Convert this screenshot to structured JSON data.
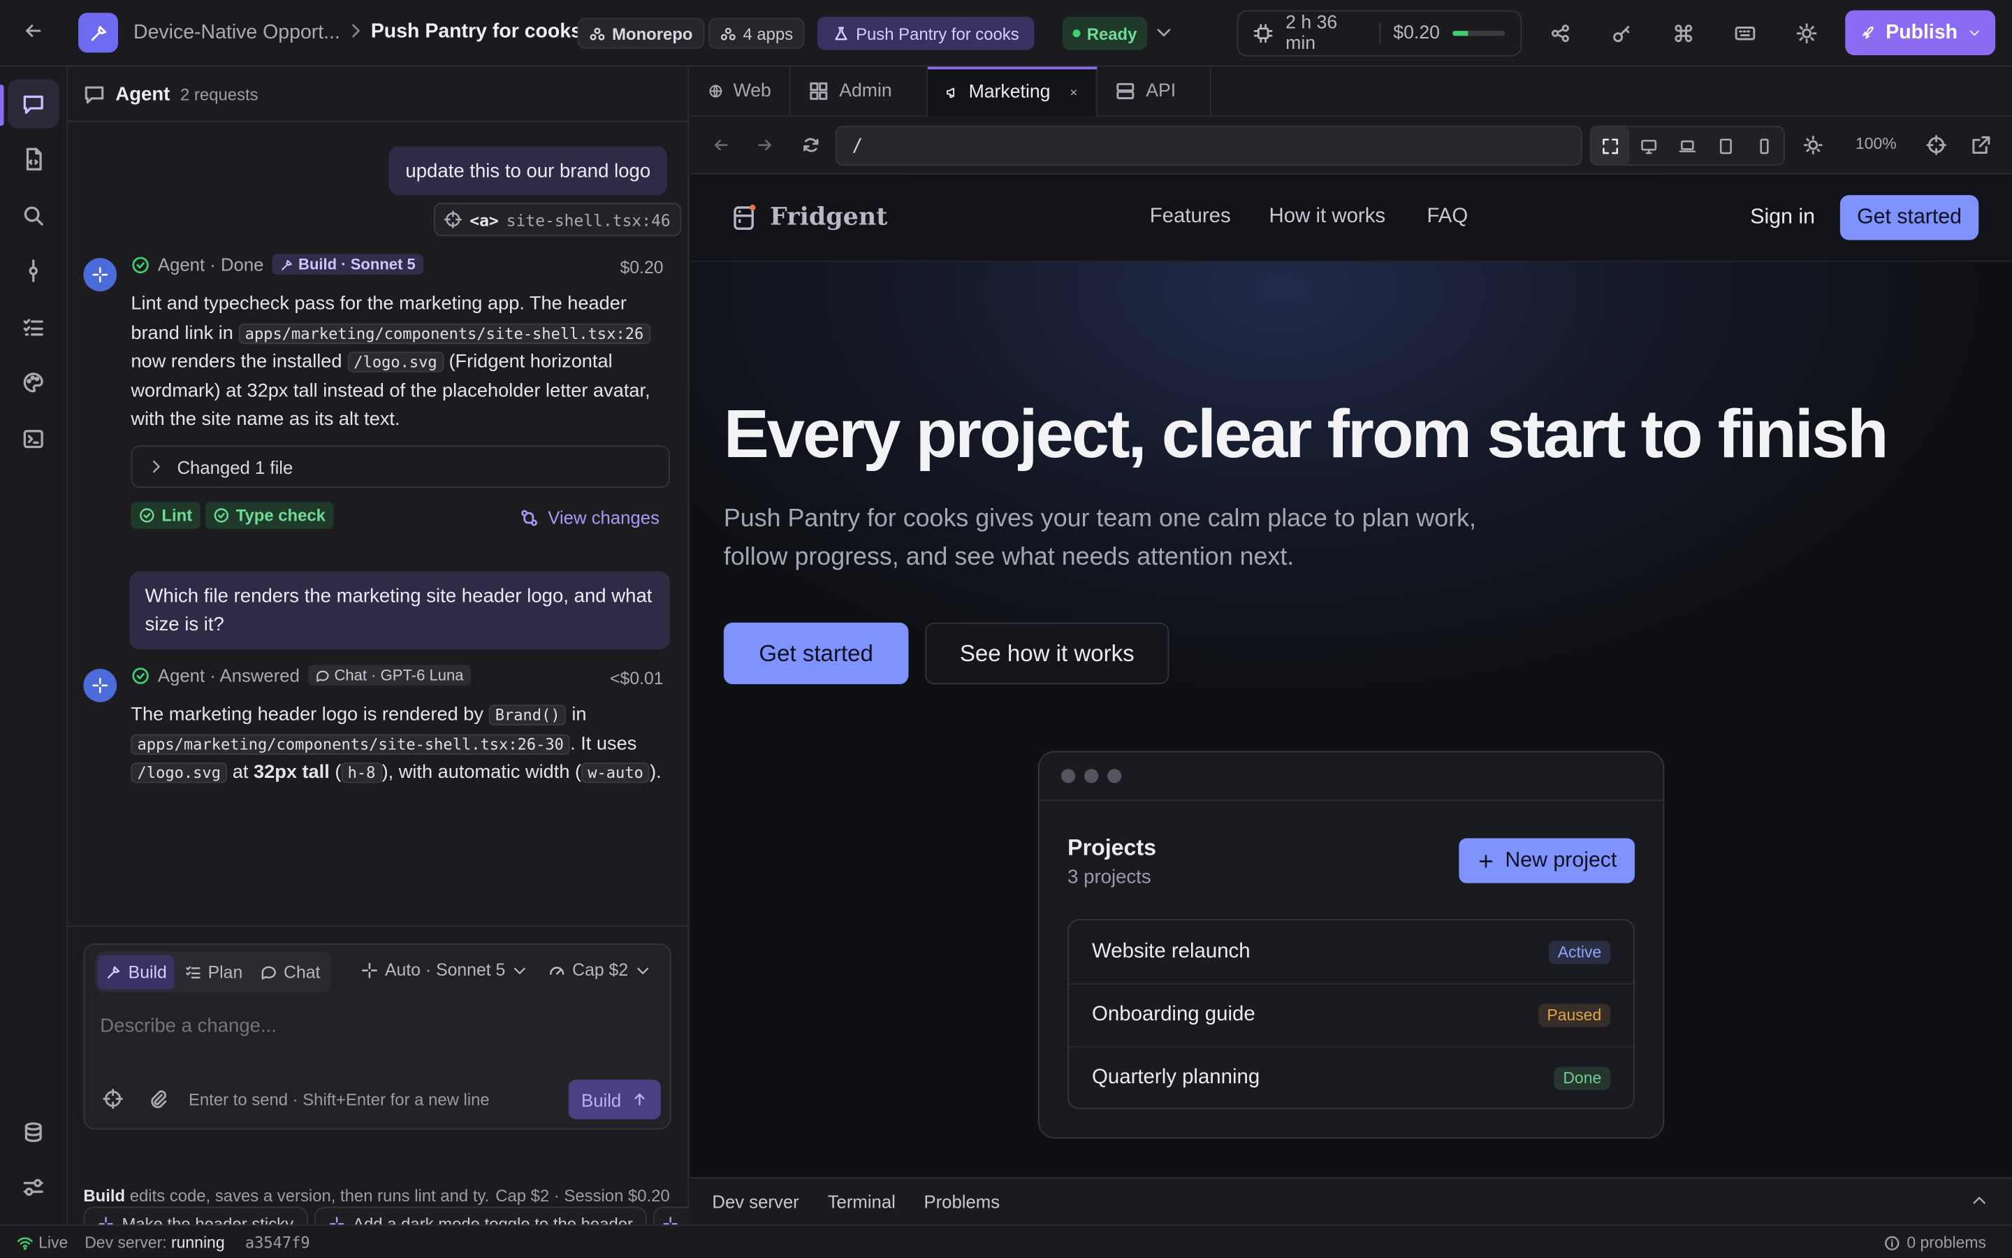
{
  "topbar": {
    "project": "Device-Native Opport...",
    "sep": ">",
    "app": "Push Pantry for cooks",
    "monorepo": "Monorepo",
    "apps_count": "4 apps",
    "app_pill": "Push Pantry for cooks",
    "status": "Ready",
    "time": "2 h 36 min",
    "cost": "$0.20",
    "budget_fraction": 0.3,
    "publish": "Publish"
  },
  "chat": {
    "title": "Agent",
    "requests": "2 requests",
    "user_msg_1": "update this to our brand logo",
    "element_ref_tag": "<a>",
    "element_ref_file": "site-shell.tsx:46",
    "agent1": {
      "status": "Agent · Done",
      "mode": "Build · Sonnet 5",
      "cost": "$0.20",
      "p1": "Lint and typecheck pass for the marketing app. The header brand link in",
      "code1": "apps/marketing/components/site-shell.tsx:26",
      "p2": "now renders the installed",
      "code2": "/logo.svg",
      "p3": "(Fridgent horizontal wordmark) at 32px tall instead of the placeholder letter avatar, with the site name as its alt text.",
      "changed": "Changed 1 file",
      "lint": "Lint",
      "typecheck": "Type check",
      "view_changes": "View changes"
    },
    "user_msg_2": "Which file renders the marketing site header logo, and what size is it?",
    "agent2": {
      "status": "Agent · Answered",
      "mode": "Chat · GPT-6 Luna",
      "cost": "<$0.01",
      "p1": "The marketing header logo is rendered by",
      "code1": "Brand()",
      "p2": "in",
      "code2": "apps/marketing/components/site-shell.tsx:26-30",
      "p3": ". It uses",
      "code3": "/logo.svg",
      "p4": "at",
      "bold": "32px tall",
      "p5": "(",
      "code4": "h-8",
      "p6": "), with automatic width (",
      "code5": "w-auto",
      "p7": ")."
    },
    "composer": {
      "build": "Build",
      "plan": "Plan",
      "chat": "Chat",
      "model": "Auto · Sonnet 5",
      "cap": "Cap $2",
      "placeholder": "Describe a change...",
      "hint": "Enter to send · Shift+Enter for a new line",
      "send": "Build"
    },
    "suggestions": [
      "Make the header sticky",
      "Add a dark mode toggle to the header"
    ],
    "footer": {
      "mode": "Build",
      "desc": "edits code, saves a version, then runs lint and ty...",
      "cap": "Cap $2 · Session $0.20"
    }
  },
  "preview": {
    "tabs": [
      "Web",
      "Admin",
      "Marketing",
      "API"
    ],
    "active_tab": "Marketing",
    "url": "/",
    "zoom": "100%",
    "site": {
      "brand": "Fridgent",
      "nav": [
        "Features",
        "How it works",
        "FAQ"
      ],
      "signin": "Sign in",
      "get_started": "Get started",
      "hero_title": "Every project, clear from start to finish",
      "hero_sub_1": "Push Pantry for cooks gives your team one calm place to plan work,",
      "hero_sub_2": "follow progress, and see what needs attention next.",
      "cta_primary": "Get started",
      "cta_secondary": "See how it works",
      "card": {
        "title": "Projects",
        "count": "3 projects",
        "new_button": "New project",
        "rows": [
          {
            "name": "Website relaunch",
            "status": "Active",
            "color": "#8fa4ff"
          },
          {
            "name": "Onboarding guide",
            "status": "Paused",
            "color": "#e0a44a"
          },
          {
            "name": "Quarterly planning",
            "status": "Done",
            "color": "#6fcf8a"
          }
        ]
      }
    },
    "bottom_tabs": [
      "Dev server",
      "Terminal",
      "Problems"
    ]
  },
  "statusbar": {
    "live": "Live",
    "dev_label": "Dev server:",
    "dev_state": "running",
    "commit": "a3547f9",
    "problems": "0 problems"
  },
  "colors": {
    "accent": "#7b74f0",
    "primary_btn": "#7f93ff",
    "ready": "#3ecf73"
  }
}
